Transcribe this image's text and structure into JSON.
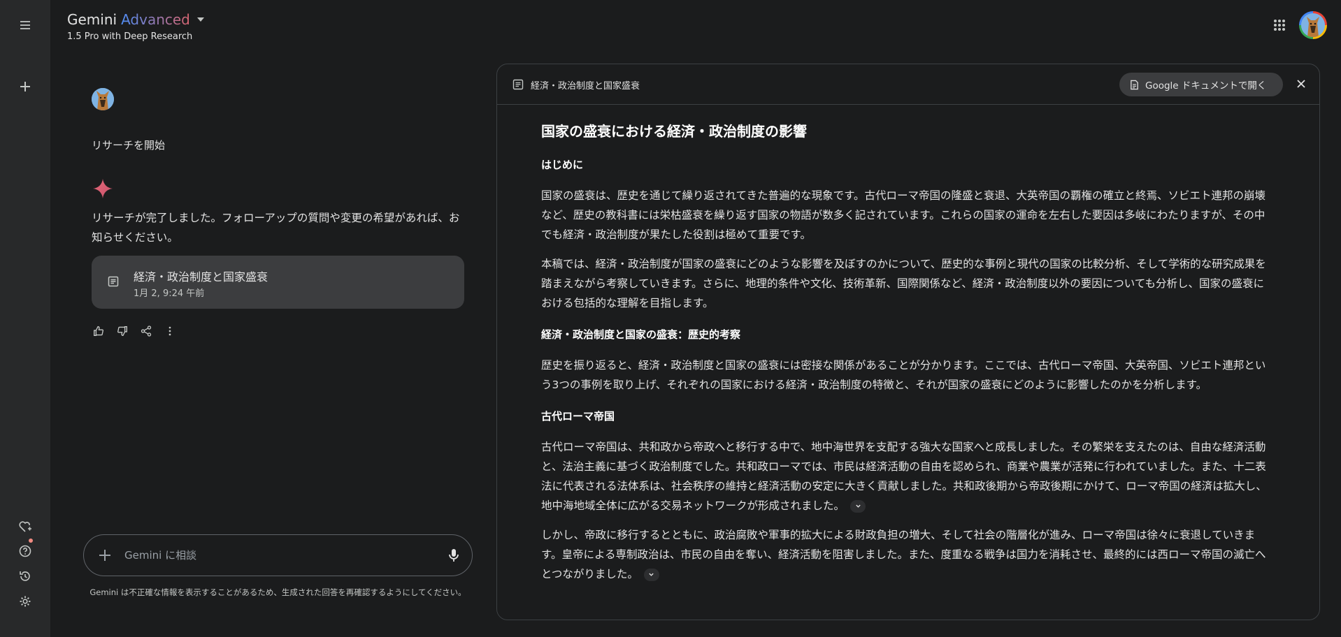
{
  "header": {
    "brand": "Gemini",
    "brand_tier": "Advanced",
    "model": "1.5 Pro with Deep Research"
  },
  "chat": {
    "user_message": "リサーチを開始",
    "reply": "リサーチが完了しました。フォローアップの質問や変更の希望があれば、お知らせください。",
    "doc_card": {
      "title": "経済・政治制度と国家盛衰",
      "date": "1月 2, 9:24 午前"
    }
  },
  "input": {
    "placeholder": "Gemini に相談"
  },
  "disclaimer": "Gemini は不正確な情報を表示することがあるため、生成された回答を再確認するようにしてください。",
  "panel": {
    "title": "経済・政治制度と国家盛衰",
    "open_button": "Google ドキュメントで開く",
    "doc_title": "国家の盛衰における経済・政治制度の影響",
    "sections": {
      "intro_heading": "はじめに",
      "intro_p1": "国家の盛衰は、歴史を通じて繰り返されてきた普遍的な現象です。古代ローマ帝国の隆盛と衰退、大英帝国の覇権の確立と終焉、ソビエト連邦の崩壊など、歴史の教科書には栄枯盛衰を繰り返す国家の物語が数多く記されています。これらの国家の運命を左右した要因は多岐にわたりますが、その中でも経済・政治制度が果たした役割は極めて重要です。",
      "intro_p2": "本稿では、経済・政治制度が国家の盛衰にどのような影響を及ぼすのかについて、歴史的な事例と現代の国家の比較分析、そして学術的な研究成果を踏まえながら考察していきます。さらに、地理的条件や文化、技術革新、国際関係など、経済・政治制度以外の要因についても分析し、国家の盛衰における包括的な理解を目指します。",
      "hist_heading": "経済・政治制度と国家の盛衰：歴史的考察",
      "hist_p1": "歴史を振り返ると、経済・政治制度と国家の盛衰には密接な関係があることが分かります。ここでは、古代ローマ帝国、大英帝国、ソビエト連邦という3つの事例を取り上げ、それぞれの国家における経済・政治制度の特徴と、それが国家の盛衰にどのように影響したのかを分析します。",
      "rome_heading": "古代ローマ帝国",
      "rome_p1": "古代ローマ帝国は、共和政から帝政へと移行する中で、地中海世界を支配する強大な国家へと成長しました。その繁栄を支えたのは、自由な経済活動と、法治主義に基づく政治制度でした。共和政ローマでは、市民は経済活動の自由を認められ、商業や農業が活発に行われていました。また、十二表法に代表される法体系は、社会秩序の維持と経済活動の安定に大きく貢献しました。共和政後期から帝政後期にかけて、ローマ帝国の経済は拡大し、地中海地域全体に広がる交易ネットワークが形成されました。",
      "rome_p2": "しかし、帝政に移行するとともに、政治腐敗や軍事的拡大による財政負担の増大、そして社会の階層化が進み、ローマ帝国は徐々に衰退していきます。皇帝による専制政治は、市民の自由を奪い、経済活動を阻害しました。また、度重なる戦争は国力を消耗させ、最終的には西ローマ帝国の滅亡へとつながりました。"
    }
  }
}
